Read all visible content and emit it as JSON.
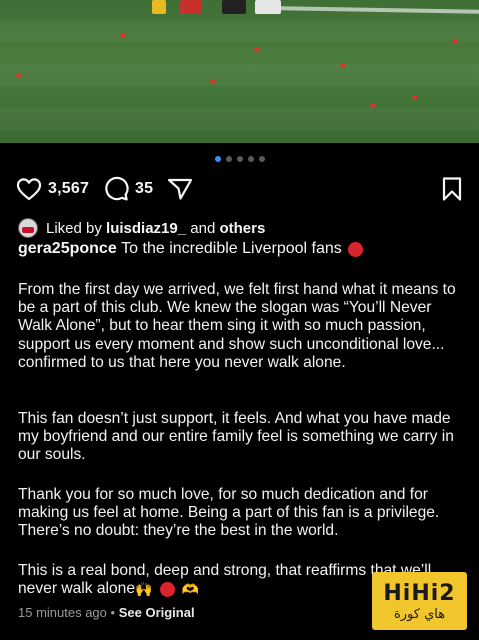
{
  "carousel": {
    "total": 5,
    "active": 0
  },
  "actions": {
    "likes_count": "3,567",
    "comments_count": "35"
  },
  "liked_by": {
    "prefix": "Liked by",
    "user": "luisdiaz19_",
    "and": "and",
    "others": "others"
  },
  "caption": {
    "username": "gera25ponce",
    "headline": "To the incredible Liverpool fans",
    "paragraphs": [
      "From the first day we arrived, we felt first hand what it means to be a part of this club. We knew the slogan was “You’ll Never Walk Alone”, but to hear them sing it with so much passion, support us every moment and show such unconditional love... confirmed to us that here you never walk alone.",
      "This fan doesn’t just support, it feels. And what you have made my boyfriend and our entire family feel is something we carry in our souls.",
      "Thank you for so much love, for so much dedication and for making us feel at home. Being a part of this fan is a privilege. There’s no doubt: they’re the best in the world.",
      "This is a real bond, deep and strong, that reaffirms that we’ll never walk alone"
    ]
  },
  "meta": {
    "time": "15 minutes ago",
    "separator": "•",
    "see_original": "See Original"
  },
  "watermark": {
    "brand": "HiHi2",
    "subtitle": "هاي كورة"
  },
  "colors": {
    "accent_blue": "#3d8ef0",
    "liverpool_red": "#d9232d",
    "logo_yellow": "#f0c62c"
  }
}
